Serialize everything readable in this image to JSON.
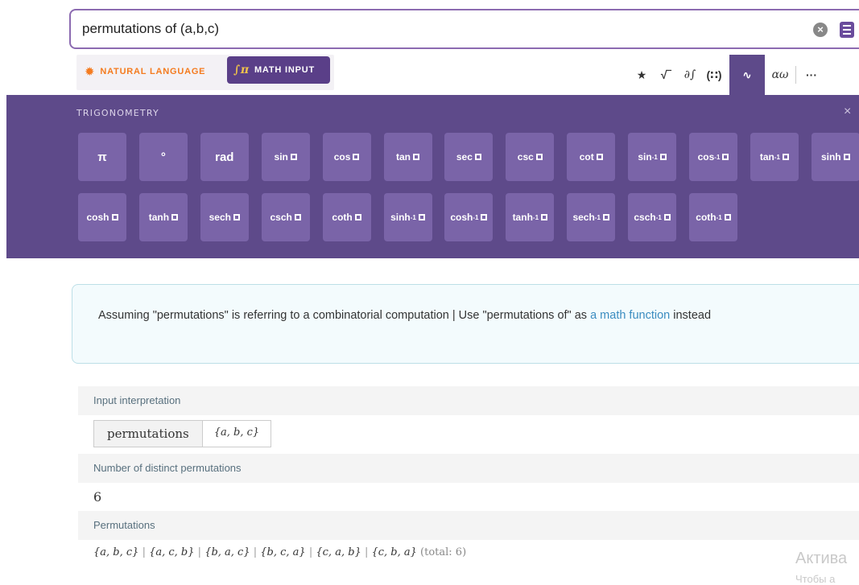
{
  "search": {
    "query": "permutations of (a,b,c)",
    "clear_icon": "clear-icon",
    "menu_icon": "menu-icon"
  },
  "modes": {
    "natural_language": "NATURAL LANGUAGE",
    "math_input": "MATH INPUT",
    "accent_color": "#f47b1f",
    "active_color": "#5a3f88"
  },
  "palette": {
    "icons": [
      {
        "name": "favorites-star-icon",
        "glyph": "★"
      },
      {
        "name": "square-root-icon",
        "glyph": "√‾"
      },
      {
        "name": "calculus-icon",
        "glyph": "∂∫"
      },
      {
        "name": "matrix-icon",
        "glyph": "(∷)"
      },
      {
        "name": "trigonometry-wave-icon",
        "glyph": "∿"
      },
      {
        "name": "greek-letters-icon",
        "glyph": "αω"
      },
      {
        "name": "more-icon",
        "glyph": "···"
      }
    ]
  },
  "trig": {
    "title": "TRIGONOMETRY",
    "close": "×",
    "row1": [
      "π",
      "°",
      "rad",
      "sin",
      "cos",
      "tan",
      "sec",
      "csc",
      "cot",
      "sin⁻¹",
      "cos⁻¹",
      "tan⁻¹",
      "sinh"
    ],
    "row2": [
      "cosh",
      "tanh",
      "sech",
      "csch",
      "coth",
      "sinh⁻¹",
      "cosh⁻¹",
      "tanh⁻¹",
      "sech⁻¹",
      "csch⁻¹",
      "coth⁻¹"
    ],
    "panel_color": "#5e4a8a",
    "key_color": "#7a64a8"
  },
  "assumption": {
    "text": "Assuming \"permutations\" is referring to a combinatorial computation | Use \"permutations of\" as",
    "link": "a math function",
    "text_after": "instead"
  },
  "pods": {
    "interpretation": {
      "title": "Input interpretation",
      "left": "permutations",
      "right": "{a, b, c}"
    },
    "count": {
      "title": "Number of distinct permutations",
      "value": "6"
    },
    "permutations": {
      "title": "Permutations",
      "items": [
        "{a, b, c}",
        "{a, c, b}",
        "{b, a, c}",
        "{b, c, a}",
        "{c, a, b}",
        "{c, b, a}"
      ],
      "total": "(total: 6)"
    }
  },
  "watermark": {
    "line1": "Актива",
    "line2": "Чтобы а"
  }
}
